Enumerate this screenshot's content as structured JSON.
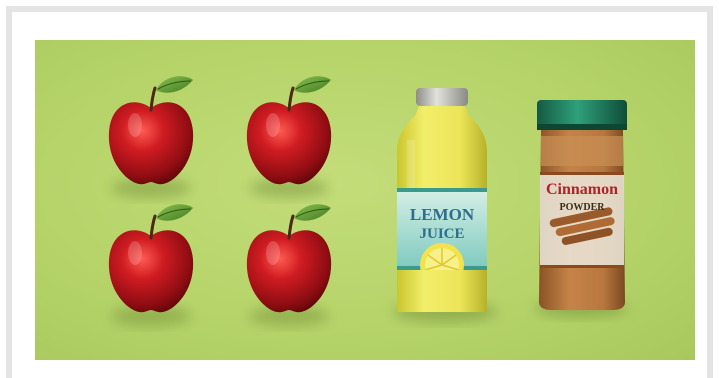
{
  "lemon_label": {
    "line1": "LEMON",
    "line2": "JUICE"
  },
  "cinnamon_label": {
    "line1": "Cinnamon",
    "line2": "POWDER"
  },
  "colors": {
    "background": "#b8d56c",
    "apple_red": "#b3121a",
    "leaf_green": "#5d9a2e",
    "lemon_juice": "#e8e04a",
    "bottle_cap": "#b8b8b0",
    "jar_cap": "#1f7a5a",
    "cinnamon": "#b0703a"
  },
  "objects": [
    "apple",
    "apple",
    "apple",
    "apple",
    "lemon-juice-bottle",
    "cinnamon-powder-jar"
  ]
}
